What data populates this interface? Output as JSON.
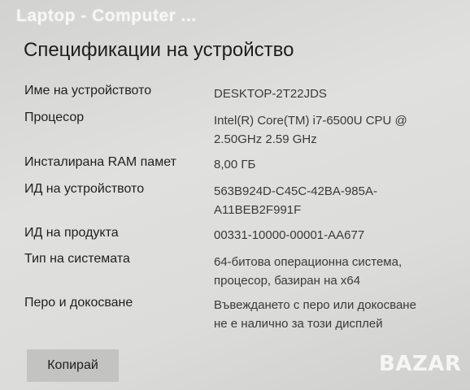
{
  "watermark": "Laptop - Computer ...",
  "title": "Спецификации на устройство",
  "specs": [
    {
      "label": "Име на устройството",
      "value": "DESKTOP-2T22JDS"
    },
    {
      "label": "Процесор",
      "value": "Intel(R) Core(TM) i7-6500U CPU @\n2.50GHz   2.59 GHz"
    },
    {
      "label": "Инсталирана RAM памет",
      "value": "8,00 ГБ"
    },
    {
      "label": "ИД на устройството",
      "value": "563B924D-C45C-42BA-985A-\nA11BEB2F991F"
    },
    {
      "label": "ИД на продукта",
      "value": "00331-10000-00001-AA677"
    },
    {
      "label": "Тип на системата",
      "value": "64-битова операционна система,\nпроцесор, базиран на x64"
    },
    {
      "label": "Перо и докосване",
      "value": "Въвеждането с перо или докосване\nне е налично за този дисплей"
    }
  ],
  "copy_button": "Копирай",
  "logo": "BAZAR"
}
